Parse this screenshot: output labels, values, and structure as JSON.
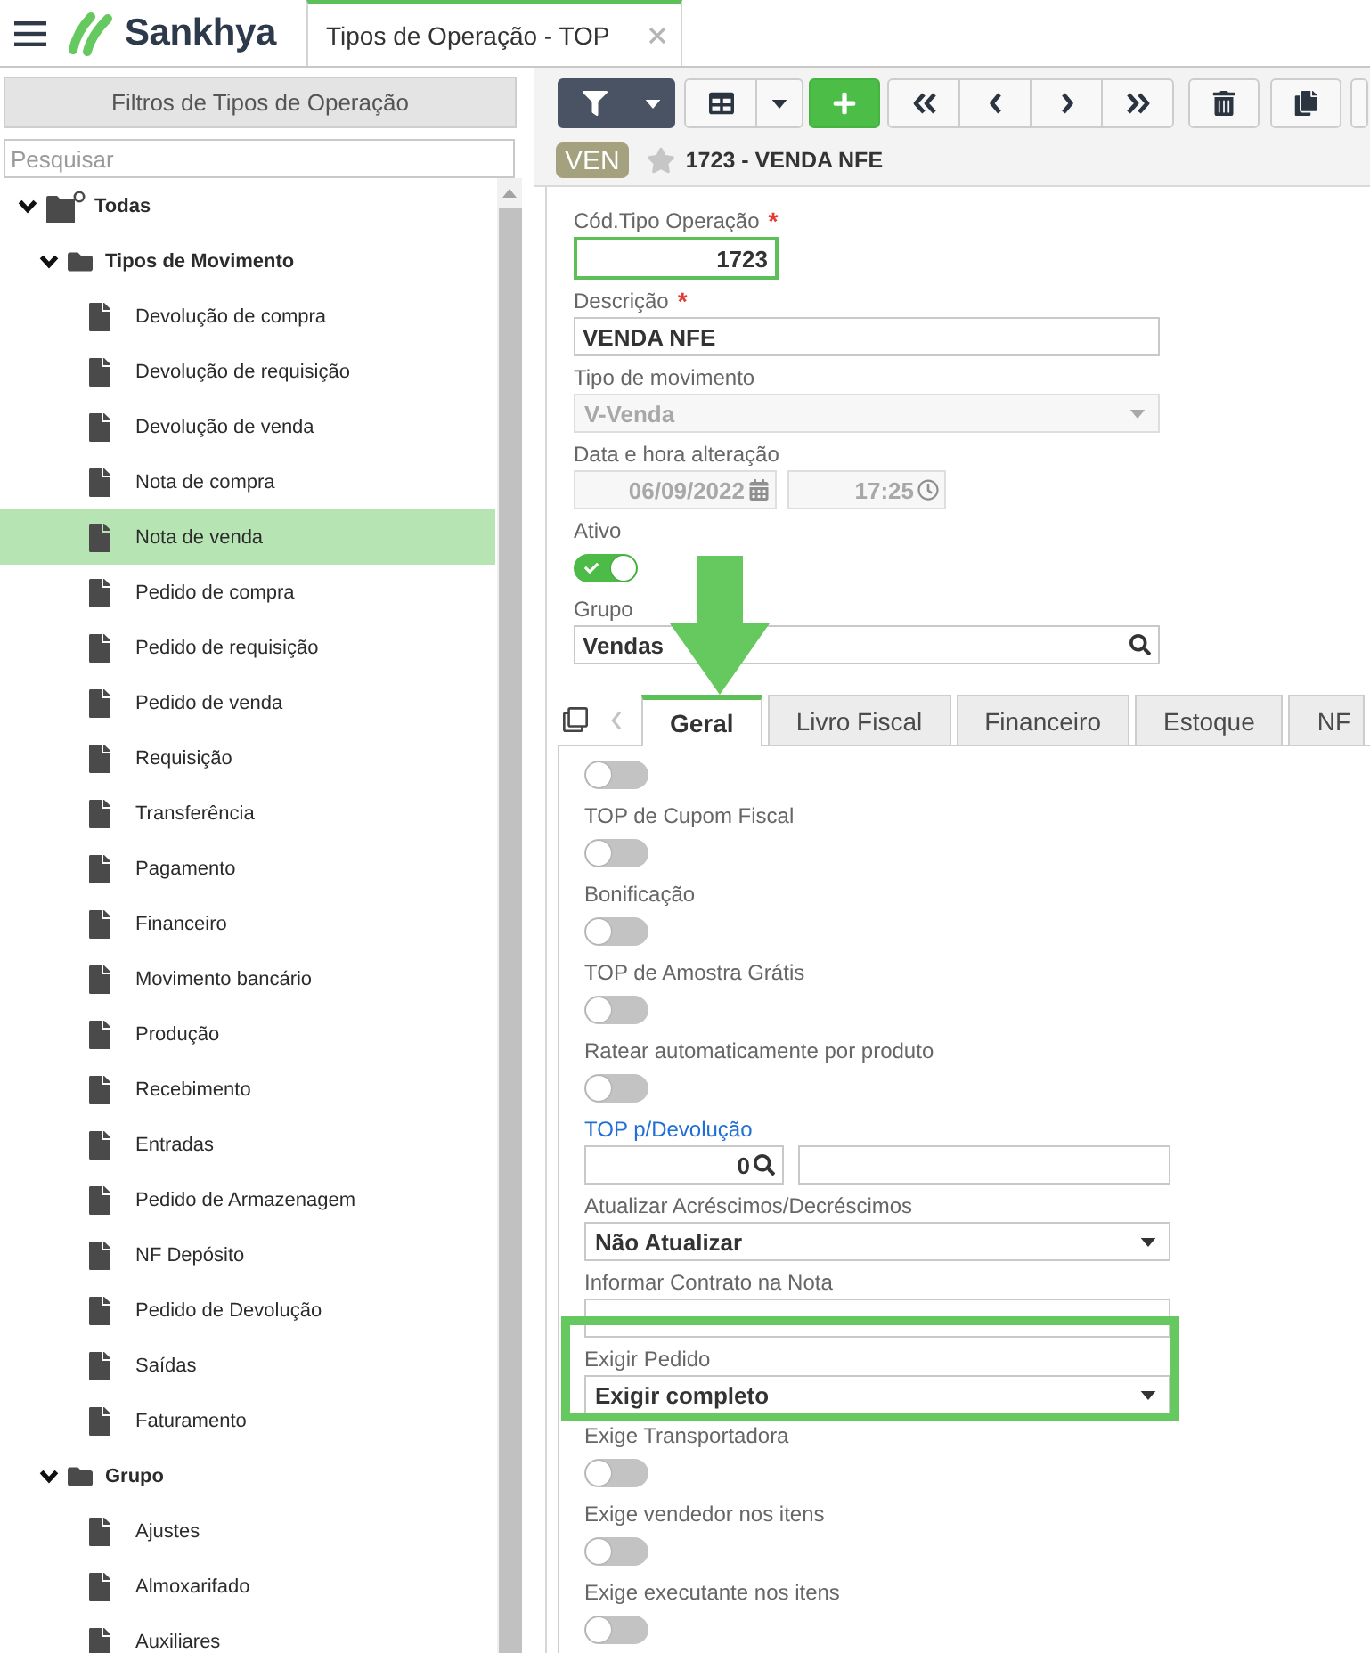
{
  "header": {
    "brand": "Sankhya",
    "tab": {
      "title": "Tipos de Operação - TOP",
      "selected": true
    }
  },
  "sidebar": {
    "title": "Filtros de Tipos de Operação",
    "search": {
      "placeholder": "Pesquisar"
    },
    "tree": [
      {
        "label": "Todas",
        "kind": "root",
        "expanded": true,
        "selected": false,
        "children": [
          {
            "label": "Tipos de Movimento",
            "kind": "folder",
            "expanded": true,
            "selected": false,
            "children": [
              {
                "label": "Devolução de compra",
                "kind": "document",
                "selected": false
              },
              {
                "label": "Devolução de requisição",
                "kind": "document",
                "selected": false
              },
              {
                "label": "Devolução de venda",
                "kind": "document",
                "selected": false
              },
              {
                "label": "Nota de compra",
                "kind": "document",
                "selected": false
              },
              {
                "label": "Nota de venda",
                "kind": "document",
                "selected": true
              },
              {
                "label": "Pedido de compra",
                "kind": "document",
                "selected": false
              },
              {
                "label": "Pedido de requisição",
                "kind": "document",
                "selected": false
              },
              {
                "label": "Pedido de venda",
                "kind": "document",
                "selected": false
              },
              {
                "label": "Requisição",
                "kind": "document",
                "selected": false
              },
              {
                "label": "Transferência",
                "kind": "document",
                "selected": false
              },
              {
                "label": "Pagamento",
                "kind": "document",
                "selected": false
              },
              {
                "label": "Financeiro",
                "kind": "document",
                "selected": false
              },
              {
                "label": "Movimento bancário",
                "kind": "document",
                "selected": false
              },
              {
                "label": "Produção",
                "kind": "document",
                "selected": false
              },
              {
                "label": "Recebimento",
                "kind": "document",
                "selected": false
              },
              {
                "label": "Entradas",
                "kind": "document",
                "selected": false
              },
              {
                "label": "Pedido de Armazenagem",
                "kind": "document",
                "selected": false
              },
              {
                "label": "NF Depósito",
                "kind": "document",
                "selected": false
              },
              {
                "label": "Pedido de Devolução",
                "kind": "document",
                "selected": false
              },
              {
                "label": "Saídas",
                "kind": "document",
                "selected": false
              },
              {
                "label": "Faturamento",
                "kind": "document",
                "selected": false
              }
            ]
          },
          {
            "label": "Grupo",
            "kind": "folder",
            "expanded": true,
            "selected": false,
            "children": [
              {
                "label": "Ajustes",
                "kind": "document",
                "selected": false
              },
              {
                "label": "Almoxarifado",
                "kind": "document",
                "selected": false
              },
              {
                "label": "Auxiliares",
                "kind": "document",
                "selected": false
              }
            ]
          }
        ]
      }
    ]
  },
  "record": {
    "badge": "VEN",
    "favorite": false,
    "title": "1723 - VENDA NFE"
  },
  "form": {
    "fields": [
      {
        "kind": "number",
        "label": "Cód.Tipo Operação",
        "required_mark": "*",
        "value": "1723",
        "focused": true
      },
      {
        "kind": "text",
        "label": "Descrição",
        "required_mark": "*",
        "value": "VENDA NFE",
        "focused": false
      },
      {
        "kind": "select",
        "label": "Tipo de movimento",
        "value": "V-Venda",
        "disabled": true
      },
      {
        "kind": "datetime",
        "label": "Data e hora alteração",
        "date": "06/09/2022",
        "time": "17:25",
        "disabled": true
      },
      {
        "kind": "toggle",
        "label": "Ativo",
        "on": true
      },
      {
        "kind": "lookup",
        "label": "Grupo",
        "value": "Vendas"
      }
    ]
  },
  "tabs": [
    {
      "label": "Geral",
      "selected": true,
      "pointed_at": true
    },
    {
      "label": "Livro Fiscal",
      "selected": false,
      "pointed_at": false
    },
    {
      "label": "Financeiro",
      "selected": false,
      "pointed_at": false
    },
    {
      "label": "Estoque",
      "selected": false,
      "pointed_at": false
    },
    {
      "label": "NF",
      "selected": false,
      "pointed_at": false
    }
  ],
  "tab_panel": {
    "fields": [
      {
        "kind": "toggle",
        "on": false
      },
      {
        "kind": "toggle",
        "label": "TOP de Cupom Fiscal",
        "on": false
      },
      {
        "kind": "toggle",
        "label": "Bonificação",
        "on": false
      },
      {
        "kind": "toggle",
        "label": "TOP de Amostra Grátis",
        "on": false
      },
      {
        "kind": "toggle",
        "label": "Ratear automaticamente por produto",
        "on": false
      },
      {
        "kind": "lookup_pair",
        "label": "TOP p/Devolução",
        "link": true,
        "code": "0"
      },
      {
        "kind": "select",
        "label": "Atualizar Acréscimos/Decréscimos",
        "value": "Não Atualizar",
        "disabled": false
      },
      {
        "kind": "select",
        "label": "Informar Contrato na Nota",
        "disabled": false
      },
      {
        "kind": "select",
        "label": "Exigir Pedido",
        "value": "Exigir completo",
        "disabled": false,
        "highlighted": true
      },
      {
        "kind": "toggle",
        "label": "Exige Transportadora",
        "on": false
      },
      {
        "kind": "toggle",
        "label": "Exige vendedor nos itens",
        "on": false
      },
      {
        "kind": "toggle",
        "label": "Exige executante nos itens",
        "on": false
      }
    ]
  }
}
